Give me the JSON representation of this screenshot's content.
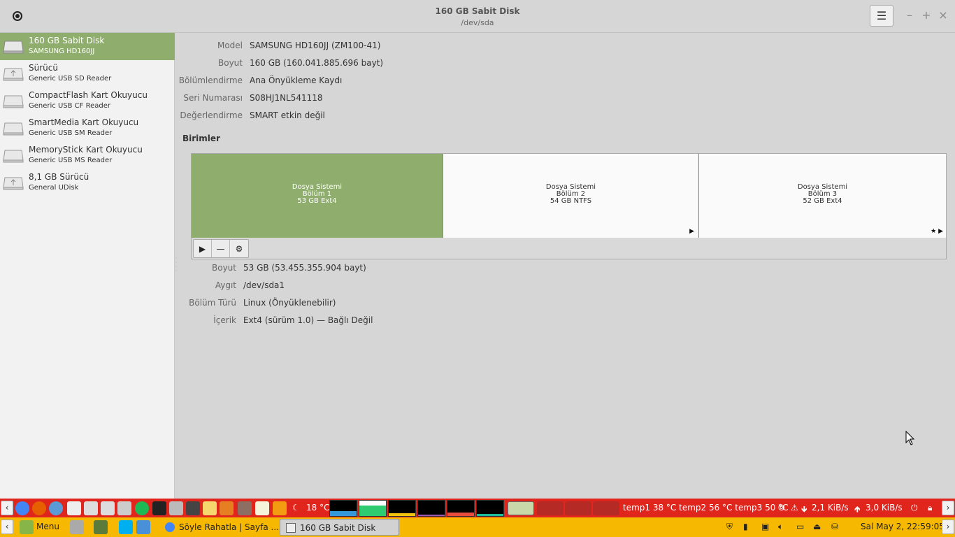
{
  "window": {
    "title": "160 GB Sabit Disk",
    "subtitle": "/dev/sda",
    "menu_icon": "hamburger-icon",
    "minimize": "–",
    "maximize": "+",
    "close": "×"
  },
  "sidebar": {
    "items": [
      {
        "name": "160 GB Sabit Disk",
        "sub": "SAMSUNG HD160JJ",
        "icon": "hard-disk-icon"
      },
      {
        "name": "Sürücü",
        "sub": "Generic USB SD Reader",
        "icon": "usb-drive-icon"
      },
      {
        "name": "CompactFlash Kart Okuyucu",
        "sub": "Generic USB CF Reader",
        "icon": "card-reader-icon"
      },
      {
        "name": "SmartMedia Kart Okuyucu",
        "sub": "Generic USB SM Reader",
        "icon": "card-reader-icon"
      },
      {
        "name": "MemoryStick Kart Okuyucu",
        "sub": "Generic USB MS Reader",
        "icon": "card-reader-icon"
      },
      {
        "name": "8,1 GB Sürücü",
        "sub": "General UDisk",
        "icon": "usb-drive-icon"
      }
    ]
  },
  "disk": {
    "props": [
      {
        "label": "Model",
        "value": "SAMSUNG HD160JJ (ZM100-41)"
      },
      {
        "label": "Boyut",
        "value": "160 GB (160.041.885.696 bayt)"
      },
      {
        "label": "Bölümlendirme",
        "value": "Ana Önyükleme Kaydı"
      },
      {
        "label": "Seri Numarası",
        "value": "S08HJ1NL541118"
      },
      {
        "label": "Değerlendirme",
        "value": "SMART etkin değil"
      }
    ],
    "volumes_heading": "Birimler",
    "volumes": [
      {
        "line1": "Dosya Sistemi",
        "line2": "Bölüm 1",
        "line3": "53 GB Ext4",
        "selected": true
      },
      {
        "line1": "Dosya Sistemi",
        "line2": "Bölüm 2",
        "line3": "54 GB NTFS",
        "marker": "▶"
      },
      {
        "line1": "Dosya Sistemi",
        "line2": "Bölüm 3",
        "line3": "52 GB Ext4",
        "marker": "★ ▶"
      }
    ],
    "volume_buttons": {
      "mount": "▶",
      "delete": "—",
      "settings": "⚙"
    },
    "selected_props": [
      {
        "label": "Boyut",
        "value": "53 GB (53.455.355.904 bayt)"
      },
      {
        "label": "Aygıt",
        "value": "/dev/sda1"
      },
      {
        "label": "Bölüm Türü",
        "value": "Linux (Önyüklenebilir)"
      },
      {
        "label": "İçerik",
        "value": "Ext4 (sürüm 1.0) — Bağlı Değil"
      }
    ]
  },
  "top_panel": {
    "left_arrow": "‹",
    "right_arrow": "›",
    "weather": "18 °C",
    "sensors": "temp1 38 °C temp2 56 °C temp3 50 °C",
    "download": "2,1 KiB/s",
    "upload": "3,0 KiB/s",
    "colors": {
      "background": "#e0251d"
    }
  },
  "bottom_panel": {
    "left_arrow": "‹",
    "right_arrow": "›",
    "menu_label": "Menu",
    "tasks": [
      {
        "label": "Söyle Rahatla | Sayfa ...",
        "icon": "chrome-icon"
      },
      {
        "label": "160 GB Sabit Disk",
        "icon": "window-icon",
        "active": true
      }
    ],
    "clock": "Sal May  2, 22:59:05",
    "colors": {
      "background": "#f6b800"
    }
  }
}
